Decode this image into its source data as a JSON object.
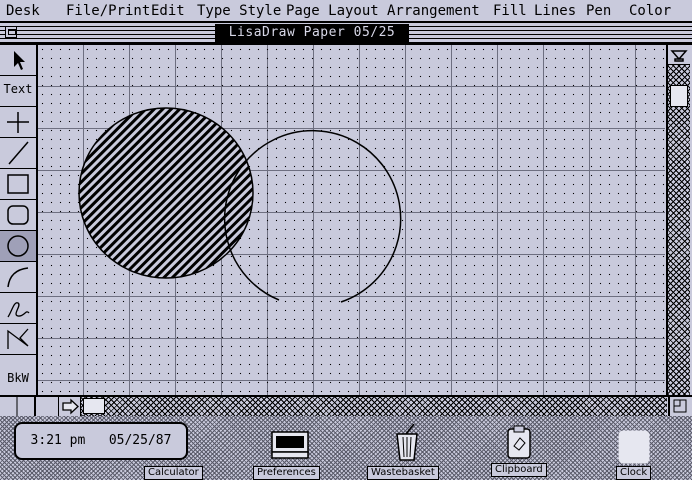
{
  "menubar": {
    "items": [
      "Desk",
      "File/Print",
      "Edit",
      "Type Style",
      "Page Layout",
      "Arrangement",
      "Fill",
      "Lines",
      "Pen",
      "Color"
    ]
  },
  "window": {
    "title": "LisaDraw Paper 05/25"
  },
  "toolbox": {
    "text_tool": "Text",
    "bkw_tool": "BkW"
  },
  "clock": {
    "time": "3:21 pm",
    "date": "05/25/87"
  },
  "desktop_icons": {
    "calculator": "Calculator",
    "preferences": "Preferences",
    "wastebasket": "Wastebasket",
    "clipboard": "Clipboard",
    "clock": "Clock"
  }
}
